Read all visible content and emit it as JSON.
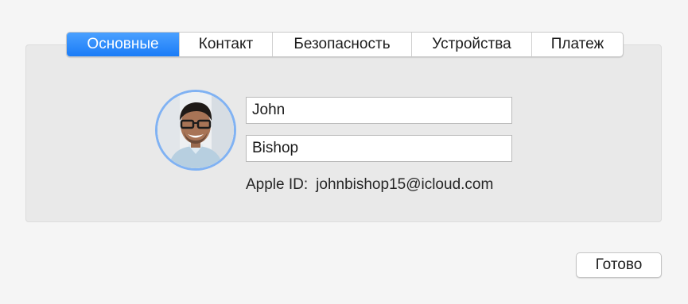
{
  "tabs": [
    {
      "label": "Основные",
      "active": true
    },
    {
      "label": "Контакт",
      "active": false
    },
    {
      "label": "Безопасность",
      "active": false
    },
    {
      "label": "Устройства",
      "active": false
    },
    {
      "label": "Платеж",
      "active": false
    }
  ],
  "profile": {
    "avatar": "user-photo-avatar",
    "first_name": "John",
    "last_name": "Bishop",
    "apple_id_label": "Apple ID:",
    "apple_id_value": "johnbishop15@icloud.com"
  },
  "footer": {
    "done_label": "Готово"
  },
  "colors": {
    "accent": "#1a7cf7",
    "avatar_ring": "#80b2f3",
    "background": "#f5f5f5",
    "panel": "#e9e9e9"
  }
}
